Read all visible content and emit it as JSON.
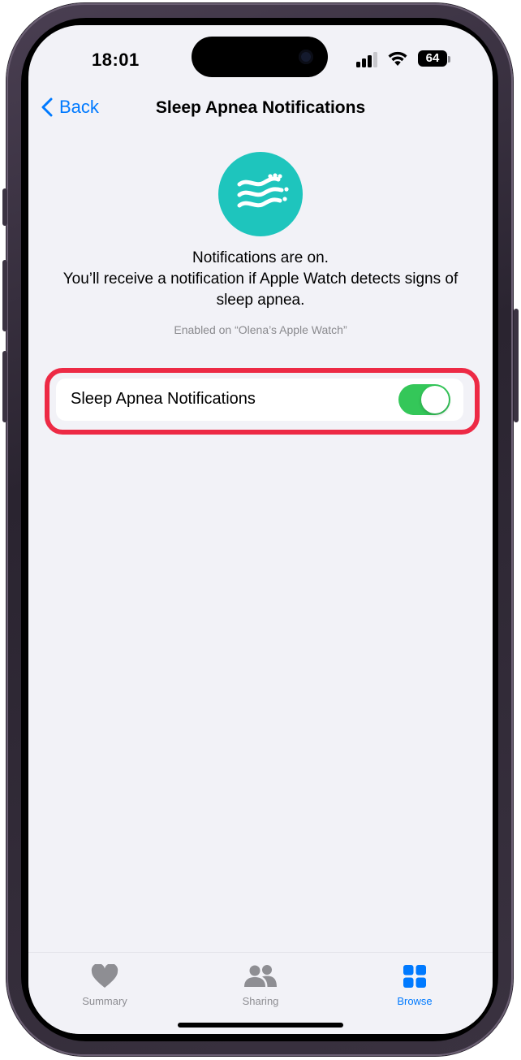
{
  "status_bar": {
    "time": "18:01",
    "battery": "64"
  },
  "nav": {
    "back_label": "Back",
    "title": "Sleep Apnea Notifications"
  },
  "feature": {
    "icon": "breathing-waves-icon",
    "icon_color": "#1ec5bd",
    "status_line": "Notifications are on.",
    "description": "You’ll receive a notification if Apple Watch detects signs of sleep apnea.",
    "enabled_on": "Enabled on “Olena’s Apple Watch”"
  },
  "setting": {
    "label": "Sleep Apnea Notifications",
    "enabled": true,
    "toggle_color": "#34c759",
    "highlight_color": "#ed2a45"
  },
  "tabs": [
    {
      "label": "Summary",
      "icon": "heart-icon",
      "active": false
    },
    {
      "label": "Sharing",
      "icon": "people-icon",
      "active": false
    },
    {
      "label": "Browse",
      "icon": "grid-icon",
      "active": true
    }
  ],
  "colors": {
    "accent": "#007aff",
    "inactive_tab": "#8e8e93",
    "background": "#f2f2f7"
  }
}
